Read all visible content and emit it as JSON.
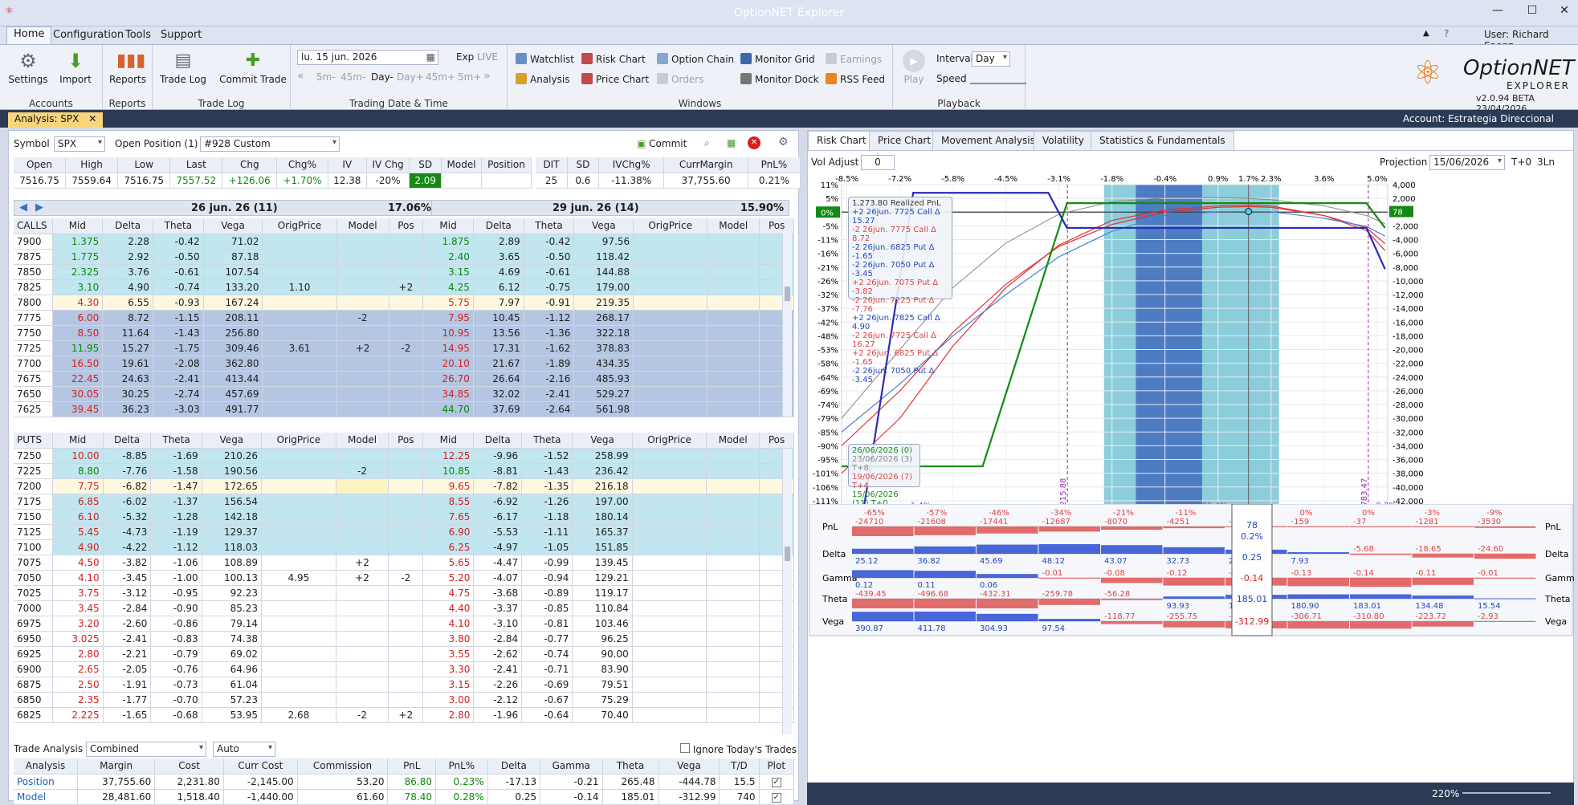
{
  "app": {
    "title": "OptionNET Explorer",
    "user": "User: Richard Saenz",
    "version": "v2.0.94 BETA 23/04/2026",
    "logo_text_1": "OptionNET",
    "logo_text_2": "EXPLORER"
  },
  "menu": [
    "Home",
    "Configuration",
    "Tools",
    "Support"
  ],
  "ribbon": {
    "accounts": {
      "settings": "Settings",
      "import": "Import",
      "label": "Accounts"
    },
    "reports": {
      "btn": "Reports",
      "label": "Reports"
    },
    "tradelog": {
      "log": "Trade Log",
      "commit": "Commit Trade",
      "label": "Trade Log"
    },
    "trading": {
      "date": "lu. 15 jun. 2026",
      "exp": "Exp",
      "live": "LIVE",
      "steps": [
        "5m-",
        "45m-",
        "Day-",
        "Day+",
        "45m+",
        "5m+"
      ],
      "label": "Trading Date & Time"
    },
    "windows": {
      "watchlist": "Watchlist",
      "analysis": "Analysis",
      "risk": "Risk Chart",
      "price": "Price Chart",
      "chain": "Option Chain",
      "orders": "Orders",
      "monitor": "Monitor Grid",
      "dock": "Monitor Dock",
      "earnings": "Earnings",
      "rss": "RSS Feed",
      "label": "Windows"
    },
    "playback": {
      "play": "Play",
      "interval_lbl": "Interval",
      "interval": "Day",
      "speed": "Speed",
      "label": "Playback"
    }
  },
  "doc": {
    "tab": "Analysis: SPX",
    "account": "Account: Estrategia Direccional"
  },
  "symbolbar": {
    "symbol_lbl": "Symbol",
    "symbol": "SPX",
    "open_pos": "Open Position (1)",
    "position": "#928 Custom",
    "commit": "Commit"
  },
  "quote": {
    "headers": [
      "Open",
      "High",
      "Low",
      "Last",
      "Chg",
      "Chg%",
      "IV",
      "IV Chg",
      "SD",
      "Model",
      "Position"
    ],
    "values": [
      "7516.75",
      "7559.64",
      "7516.75",
      "7557.52",
      "+126.06",
      "+1.70%",
      "12.38",
      "-20%",
      "2.09",
      "",
      ""
    ],
    "headers2": [
      "DIT",
      "SD",
      "IVChg%",
      "CurrMargin",
      "PnL%"
    ],
    "values2": [
      "25",
      "0.6",
      "-11.38%",
      "37,755.60",
      "0.21%"
    ]
  },
  "calls": {
    "label": "CALLS",
    "exp1": "26 jun. 26 (11)",
    "iv1": "17.06%",
    "exp2": "29 jun. 26 (14)",
    "iv2": "15.90%",
    "cols": [
      "Mid",
      "Delta",
      "Theta",
      "Vega",
      "OrigPrice",
      "Model",
      "Pos"
    ],
    "rows": [
      {
        "strike": "7900",
        "a": [
          "1.375",
          "2.28",
          "-0.42",
          "71.02",
          "",
          "",
          ""
        ],
        "b": [
          "1.875",
          "2.89",
          "-0.42",
          "97.56",
          "",
          "",
          ""
        ],
        "c": "lt"
      },
      {
        "strike": "7875",
        "a": [
          "1.775",
          "2.92",
          "-0.50",
          "87.18",
          "",
          "",
          ""
        ],
        "b": [
          "2.40",
          "3.65",
          "-0.50",
          "118.42",
          "",
          "",
          ""
        ],
        "c": "lt"
      },
      {
        "strike": "7850",
        "a": [
          "2.325",
          "3.76",
          "-0.61",
          "107.54",
          "",
          "",
          ""
        ],
        "b": [
          "3.15",
          "4.69",
          "-0.61",
          "144.88",
          "",
          "",
          ""
        ],
        "c": "lt"
      },
      {
        "strike": "7825",
        "a": [
          "3.10",
          "4.90",
          "-0.74",
          "133.20",
          "1.10",
          "",
          "+2"
        ],
        "b": [
          "4.25",
          "6.12",
          "-0.75",
          "179.00",
          "",
          "",
          ""
        ],
        "c": "lt"
      },
      {
        "strike": "7800",
        "a": [
          "4.30",
          "6.55",
          "-0.93",
          "167.24",
          "",
          "",
          ""
        ],
        "b": [
          "5.75",
          "7.97",
          "-0.91",
          "219.35",
          "",
          "",
          ""
        ],
        "c": "cur"
      },
      {
        "strike": "7775",
        "a": [
          "6.00",
          "8.72",
          "-1.15",
          "208.11",
          "",
          "-2",
          ""
        ],
        "b": [
          "7.95",
          "10.45",
          "-1.12",
          "268.17",
          "",
          "",
          ""
        ],
        "c": "dk"
      },
      {
        "strike": "7750",
        "a": [
          "8.50",
          "11.64",
          "-1.43",
          "256.80",
          "",
          "",
          ""
        ],
        "b": [
          "10.95",
          "13.56",
          "-1.36",
          "322.18",
          "",
          "",
          ""
        ],
        "c": "dk"
      },
      {
        "strike": "7725",
        "a": [
          "11.95",
          "15.27",
          "-1.75",
          "309.46",
          "3.61",
          "+2",
          "-2"
        ],
        "b": [
          "14.95",
          "17.31",
          "-1.62",
          "378.83",
          "",
          "",
          ""
        ],
        "c": "dk"
      },
      {
        "strike": "7700",
        "a": [
          "16.50",
          "19.61",
          "-2.08",
          "362.80",
          "",
          "",
          ""
        ],
        "b": [
          "20.10",
          "21.67",
          "-1.89",
          "434.35",
          "",
          "",
          ""
        ],
        "c": "dk"
      },
      {
        "strike": "7675",
        "a": [
          "22.45",
          "24.63",
          "-2.41",
          "413.44",
          "",
          "",
          ""
        ],
        "b": [
          "26.70",
          "26.64",
          "-2.16",
          "485.93",
          "",
          "",
          ""
        ],
        "c": "dk"
      },
      {
        "strike": "7650",
        "a": [
          "30.05",
          "30.25",
          "-2.74",
          "457.69",
          "",
          "",
          ""
        ],
        "b": [
          "34.85",
          "32.02",
          "-2.41",
          "529.27",
          "",
          "",
          ""
        ],
        "c": "dk"
      },
      {
        "strike": "7625",
        "a": [
          "39.45",
          "36.23",
          "-3.03",
          "491.77",
          "",
          "",
          ""
        ],
        "b": [
          "44.70",
          "37.69",
          "-2.64",
          "561.98",
          "",
          "",
          ""
        ],
        "c": "dk"
      }
    ]
  },
  "puts": {
    "label": "PUTS",
    "rows": [
      {
        "strike": "7250",
        "a": [
          "10.00",
          "-8.85",
          "-1.69",
          "210.26",
          "",
          "",
          ""
        ],
        "b": [
          "12.25",
          "-9.96",
          "-1.52",
          "258.99",
          "",
          "",
          ""
        ],
        "c": "lt"
      },
      {
        "strike": "7225",
        "a": [
          "8.80",
          "-7.76",
          "-1.58",
          "190.56",
          "",
          "-2",
          ""
        ],
        "b": [
          "10.85",
          "-8.81",
          "-1.43",
          "236.42",
          "",
          "",
          ""
        ],
        "c": "lt"
      },
      {
        "strike": "7200",
        "a": [
          "7.75",
          "-6.82",
          "-1.47",
          "172.65",
          "",
          "",
          ""
        ],
        "b": [
          "9.65",
          "-7.82",
          "-1.35",
          "216.18",
          "",
          "",
          ""
        ],
        "c": "cur"
      },
      {
        "strike": "7175",
        "a": [
          "6.85",
          "-6.02",
          "-1.37",
          "156.54",
          "",
          "",
          ""
        ],
        "b": [
          "8.55",
          "-6.92",
          "-1.26",
          "197.00",
          "",
          "",
          ""
        ],
        "c": "lt"
      },
      {
        "strike": "7150",
        "a": [
          "6.10",
          "-5.32",
          "-1.28",
          "142.18",
          "",
          "",
          ""
        ],
        "b": [
          "7.65",
          "-6.17",
          "-1.18",
          "180.14",
          "",
          "",
          ""
        ],
        "c": "lt"
      },
      {
        "strike": "7125",
        "a": [
          "5.45",
          "-4.73",
          "-1.19",
          "129.37",
          "",
          "",
          ""
        ],
        "b": [
          "6.90",
          "-5.53",
          "-1.11",
          "165.37",
          "",
          "",
          ""
        ],
        "c": "lt"
      },
      {
        "strike": "7100",
        "a": [
          "4.90",
          "-4.22",
          "-1.12",
          "118.03",
          "",
          "",
          ""
        ],
        "b": [
          "6.25",
          "-4.97",
          "-1.05",
          "151.85",
          "",
          "",
          ""
        ],
        "c": "lt"
      },
      {
        "strike": "7075",
        "a": [
          "4.50",
          "-3.82",
          "-1.06",
          "108.89",
          "",
          "+2",
          ""
        ],
        "b": [
          "5.65",
          "-4.47",
          "-0.99",
          "139.45",
          "",
          "",
          ""
        ],
        "c": "w"
      },
      {
        "strike": "7050",
        "a": [
          "4.10",
          "-3.45",
          "-1.00",
          "100.13",
          "4.95",
          "+2",
          "-2"
        ],
        "b": [
          "5.20",
          "-4.07",
          "-0.94",
          "129.21",
          "",
          "",
          ""
        ],
        "c": "w"
      },
      {
        "strike": "7025",
        "a": [
          "3.75",
          "-3.12",
          "-0.95",
          "92.23",
          "",
          "",
          ""
        ],
        "b": [
          "4.75",
          "-3.68",
          "-0.89",
          "119.17",
          "",
          "",
          ""
        ],
        "c": "w"
      },
      {
        "strike": "7000",
        "a": [
          "3.45",
          "-2.84",
          "-0.90",
          "85.23",
          "",
          "",
          ""
        ],
        "b": [
          "4.40",
          "-3.37",
          "-0.85",
          "110.84",
          "",
          "",
          ""
        ],
        "c": "w"
      },
      {
        "strike": "6975",
        "a": [
          "3.20",
          "-2.60",
          "-0.86",
          "79.14",
          "",
          "",
          ""
        ],
        "b": [
          "4.10",
          "-3.10",
          "-0.81",
          "103.46",
          "",
          "",
          ""
        ],
        "c": "w"
      },
      {
        "strike": "6950",
        "a": [
          "3.025",
          "-2.41",
          "-0.83",
          "74.38",
          "",
          "",
          ""
        ],
        "b": [
          "3.80",
          "-2.84",
          "-0.77",
          "96.25",
          "",
          "",
          ""
        ],
        "c": "w"
      },
      {
        "strike": "6925",
        "a": [
          "2.80",
          "-2.21",
          "-0.79",
          "69.02",
          "",
          "",
          ""
        ],
        "b": [
          "3.55",
          "-2.62",
          "-0.74",
          "90.00",
          "",
          "",
          ""
        ],
        "c": "w"
      },
      {
        "strike": "6900",
        "a": [
          "2.65",
          "-2.05",
          "-0.76",
          "64.96",
          "",
          "",
          ""
        ],
        "b": [
          "3.30",
          "-2.41",
          "-0.71",
          "83.90",
          "",
          "",
          ""
        ],
        "c": "w"
      },
      {
        "strike": "6875",
        "a": [
          "2.50",
          "-1.91",
          "-0.73",
          "61.04",
          "",
          "",
          ""
        ],
        "b": [
          "3.15",
          "-2.26",
          "-0.69",
          "79.51",
          "",
          "",
          ""
        ],
        "c": "w"
      },
      {
        "strike": "6850",
        "a": [
          "2.35",
          "-1.77",
          "-0.70",
          "57.23",
          "",
          "",
          ""
        ],
        "b": [
          "3.00",
          "-2.12",
          "-0.67",
          "75.29",
          "",
          "",
          ""
        ],
        "c": "w"
      },
      {
        "strike": "6825",
        "a": [
          "2.225",
          "-1.65",
          "-0.68",
          "53.95",
          "2.68",
          "-2",
          "+2"
        ],
        "b": [
          "2.80",
          "-1.96",
          "-0.64",
          "70.40",
          "",
          "",
          ""
        ],
        "c": "w"
      }
    ]
  },
  "trade_analysis": {
    "label": "Trade Analysis",
    "mode": "Combined",
    "auto": "Auto",
    "ignore": "Ignore Today's Trades",
    "cols": [
      "Analysis",
      "Margin",
      "Cost",
      "Curr Cost",
      "Commission",
      "PnL",
      "PnL%",
      "Delta",
      "Gamma",
      "Theta",
      "Vega",
      "T/D",
      "Plot"
    ],
    "rows": [
      [
        "Position",
        "37,755.60",
        "2,231.80",
        "-2,145.00",
        "53.20",
        "86.80",
        "0.23%",
        "-17.13",
        "-0.21",
        "265.48",
        "-444.78",
        "15.5"
      ],
      [
        "Model",
        "28,481.60",
        "1,518.40",
        "-1,440.00",
        "61.60",
        "78.40",
        "0.28%",
        "0.25",
        "-0.14",
        "185.01",
        "-312.99",
        "740"
      ]
    ]
  },
  "right": {
    "tabs": [
      "Risk Chart",
      "Price Chart",
      "Movement Analysis",
      "Volatility",
      "Statistics & Fundamentals"
    ],
    "vol_adjust": "Vol Adjust",
    "vol_val": "0",
    "projection": "Projection",
    "proj_date": "15/06/2026",
    "t0": "T+0",
    "ln": "3Ln",
    "legend_title": "1,273.80 Realized PnL",
    "legend": [
      "+2 26jun. 7725 Call Δ  15.27",
      "-2 26jun. 7775 Call Δ  8.72",
      "-2 26jun. 6825 Put Δ  -1.65",
      "-2 26jun. 7050 Put Δ  -3.45",
      "+2 26jun. 7075 Put Δ  -3.82",
      "-2 26jun. 7225 Put Δ  -7.76",
      "+2 26jun. 7825 Call Δ  4.90",
      "-2 26jun. 7725 Call Δ  16.27",
      "+2 26jun. 6825 Put Δ  -1.65",
      "-2 26jun. 7050 Put Δ  -3.45"
    ],
    "dates": [
      "26/06/2026 (0)",
      "23/06/2026 (3) T+8",
      "19/06/2026 (7) T+4",
      "15/06/2026 (11) T+0"
    ],
    "zoom": "220%"
  },
  "chart_data": {
    "type": "line",
    "x_ticks": [
      "6800",
      "6900",
      "7000",
      "7100",
      "7200",
      "7300",
      "7400",
      "7500",
      "7557.52",
      "7600",
      "7700",
      "7800"
    ],
    "top_pct": [
      "-8.5%",
      "-7.2%",
      "-5.8%",
      "-4.5%",
      "-3.1%",
      "-1.8%",
      "-0.4%",
      "0.9%",
      "1.7%",
      "2.3%",
      "3.6%",
      "5.0%"
    ],
    "y_left": [
      "11%",
      "5%",
      "0%",
      "-5%",
      "-11%",
      "-16%",
      "-21%",
      "-26%",
      "-32%",
      "-37%",
      "-42%",
      "-48%",
      "-53%",
      "-58%",
      "-64%",
      "-69%",
      "-74%",
      "-79%",
      "-85%",
      "-90%",
      "-95%",
      "-101%",
      "-106%",
      "-111%",
      "-117%"
    ],
    "y_right": [
      "4,000",
      "2,000",
      "78",
      "-2,000",
      "-4,000",
      "-6,000",
      "-8,000",
      "-10,000",
      "-12,000",
      "-14,000",
      "-16,000",
      "-18,000",
      "-20,000",
      "-22,000",
      "-24,000",
      "-26,000",
      "-28,000",
      "-30,000",
      "-32,000",
      "-34,000",
      "-36,000",
      "-38,000",
      "-40,000",
      "-42,000",
      "-44,000"
    ],
    "xlim": [
      6790,
      7820
    ],
    "ylim": [
      -44000,
      4000
    ],
    "annotations": [
      "1.4%",
      "7215.88",
      "89.4%",
      "7783.47",
      "-9.2%"
    ],
    "expiration": {
      "x": [
        6790,
        6832,
        6925,
        7180,
        7215,
        7780,
        7815
      ],
      "y": [
        -43000,
        -43000,
        2800,
        2800,
        -2300,
        -2300,
        -8300
      ]
    },
    "t_minus": {
      "x": [
        6790,
        7056,
        7215,
        7780,
        7815
      ],
      "y": [
        -37000,
        -37000,
        1300,
        1300,
        -2300
      ]
    },
    "tplus8": {
      "x": [
        6790,
        6900,
        7000,
        7100,
        7200,
        7300,
        7400,
        7500,
        7557,
        7600,
        7700,
        7780,
        7815
      ],
      "y": [
        -38000,
        -30000,
        -19500,
        -11000,
        -4800,
        -1200,
        300,
        900,
        1000,
        900,
        -500,
        -2700,
        -5600
      ]
    },
    "tplus4": {
      "x": [
        6790,
        6900,
        7000,
        7100,
        7200,
        7300,
        7400,
        7500,
        7557,
        7600,
        7700,
        7780,
        7815
      ],
      "y": [
        -34000,
        -26000,
        -17500,
        -10500,
        -5000,
        -1800,
        0,
        700,
        800,
        700,
        -500,
        -2300,
        -4600
      ]
    },
    "tplus0": {
      "x": [
        6790,
        6900,
        7000,
        7100,
        7200,
        7300,
        7400,
        7500,
        7557,
        7600,
        7700,
        7780,
        7815
      ],
      "y": [
        -32000,
        -25000,
        -18000,
        -12000,
        -6500,
        -2800,
        -500,
        50,
        78,
        50,
        -900,
        -2100,
        -3500
      ]
    },
    "gray": {
      "x": [
        6790,
        6900,
        7000,
        7100,
        7200,
        7300,
        7400,
        7500,
        7557,
        7600,
        7700,
        7780,
        7815
      ],
      "y": [
        -30000,
        -20000,
        -11000,
        -4500,
        -300,
        1500,
        2100,
        2100,
        2000,
        1800,
        900,
        -500,
        -1700
      ]
    }
  },
  "bottom_panel": {
    "labels": [
      "PnL",
      "Delta",
      "Gamma",
      "Theta",
      "Vega"
    ],
    "center": [
      "78",
      "0.2%",
      "0.25",
      "-0.14",
      "185.01",
      "-312.99"
    ],
    "pnl_pct": [
      "-65%",
      "-57%",
      "-46%",
      "-34%",
      "-21%",
      "-11%",
      "-4%",
      "0%",
      "0%",
      "-3%",
      "-9%"
    ],
    "pnl_val": [
      "-24710",
      "-21608",
      "-17441",
      "-12687",
      "-8070",
      "-4251",
      "-1585",
      "-159",
      "-37",
      "-1281",
      "-3530"
    ],
    "delta": [
      "25.12",
      "36.82",
      "45.69",
      "48.12",
      "43.07",
      "32.73",
      "20.50",
      "7.93",
      "-5.68",
      "-18.65",
      "-24.60"
    ],
    "gamma": [
      "0.12",
      "0.11",
      "0.06",
      "-0.01",
      "-0.08",
      "-0.12",
      "-0.12",
      "-0.13",
      "-0.14",
      "-0.11",
      "-0.01"
    ],
    "theta": [
      "-439.45",
      "-496.68",
      "-432.31",
      "-259.78",
      "-56.28",
      "93.93",
      "161.61",
      "180.90",
      "183.01",
      "134.48",
      "15.54"
    ],
    "vega": [
      "390.87",
      "411.78",
      "304.93",
      "97.54",
      "-118.77",
      "-255.75",
      "-298.42",
      "-306.71",
      "-310.80",
      "-223.72",
      "-2.93"
    ]
  },
  "colors": {
    "accent": "#2b3a55",
    "green": "#138a13",
    "red": "#d42020",
    "highlight_dark": "#4d7cc2",
    "highlight_light": "#8ccddb"
  }
}
